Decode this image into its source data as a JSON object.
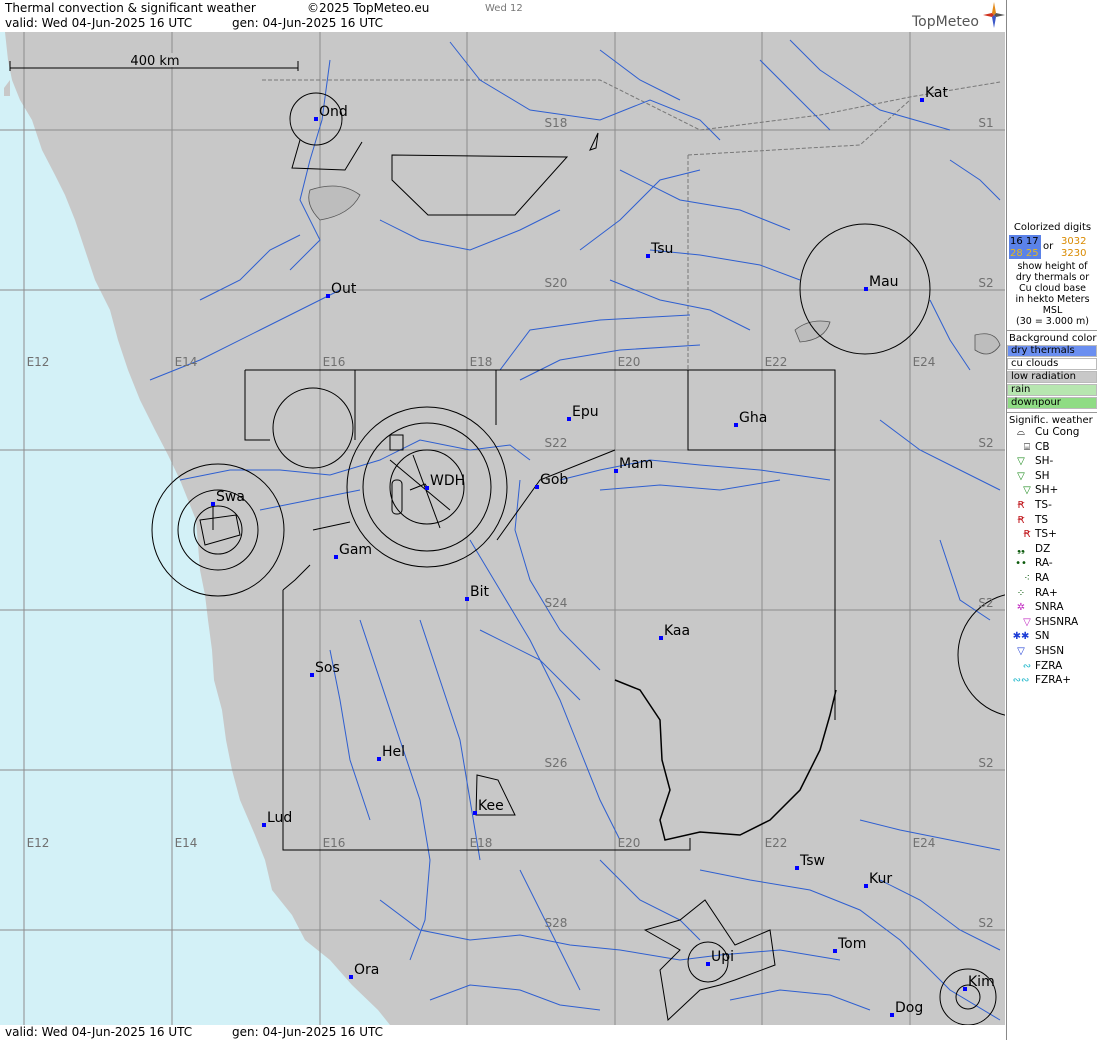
{
  "header": {
    "title": "Thermal convection & significant weather",
    "copyright": "©2025 TopMeteo.eu",
    "tab": "Wed 12",
    "valid": "valid:  Wed  04-Jun-2025  16 UTC",
    "generated": "gen: 04-Jun-2025 16 UTC",
    "logo": "TopMeteo"
  },
  "footer": {
    "valid": "valid:  Wed  04-Jun-2025  16 UTC",
    "generated": "gen: 04-Jun-2025 16 UTC"
  },
  "map": {
    "scale_label": "400 km",
    "colors": {
      "sea": "#d3f1f7",
      "land": "#c8c8c8",
      "river": "#2f5fd0",
      "grid": "#8c8c8c",
      "station": "#0000ff"
    },
    "places": [
      {
        "name": "Ond"
      },
      {
        "name": "Kat"
      },
      {
        "name": "Tsu"
      },
      {
        "name": "Mau"
      },
      {
        "name": "Out"
      },
      {
        "name": "Epu"
      },
      {
        "name": "Gha"
      },
      {
        "name": "Mam"
      },
      {
        "name": "Swa"
      },
      {
        "name": "WDH"
      },
      {
        "name": "Gob"
      },
      {
        "name": "Gam"
      },
      {
        "name": "Bit"
      },
      {
        "name": "Kaa"
      },
      {
        "name": "Sos"
      },
      {
        "name": "Hel"
      },
      {
        "name": "Kee"
      },
      {
        "name": "Lud"
      },
      {
        "name": "Tsw"
      },
      {
        "name": "Kur"
      },
      {
        "name": "Tom"
      },
      {
        "name": "Upi"
      },
      {
        "name": "Ora"
      },
      {
        "name": "Kim"
      },
      {
        "name": "Dog"
      }
    ],
    "lat_labels": [
      "S18",
      "S1",
      "S20",
      "S2",
      "S22",
      "S2",
      "S24",
      "S2",
      "S26",
      "S2",
      "S28",
      "S2"
    ],
    "lon_labels_top": [
      "E12",
      "E14",
      "E16",
      "E18",
      "E20",
      "E22",
      "E24"
    ],
    "lon_labels_bottom": [
      "E12",
      "E14",
      "E16",
      "E18",
      "E20",
      "E22",
      "E24"
    ]
  },
  "legend": {
    "colorized_title": "Colorized digits",
    "digits": {
      "a": "16 17",
      "b": "28 25",
      "or": "or",
      "c": "3032",
      "d": "3230"
    },
    "desc": [
      "show height of",
      "dry thermals or",
      "Cu cloud base",
      "in hekto Meters",
      "MSL",
      "(30 = 3.000 m)"
    ],
    "background_title": "Background color",
    "background": [
      {
        "label": "dry thermals",
        "color": "#6b8ff0"
      },
      {
        "label": "cu clouds",
        "color": "#ffffff"
      },
      {
        "label": "low radiation",
        "color": "#c8c8c8"
      },
      {
        "label": "rain",
        "color": "#b7e6b0"
      },
      {
        "label": "downpour",
        "color": "#8fdc84"
      }
    ],
    "weather_title": "Signific. weather",
    "weather": [
      {
        "label": "Cu Cong",
        "icon": "cu-cong-icon",
        "glyph": "⌓",
        "color": "#000000"
      },
      {
        "label": "CB",
        "icon": "cb-icon",
        "glyph": "⌸",
        "color": "#000000"
      },
      {
        "label": "SH-",
        "icon": "shower-light-icon",
        "glyph": "▽",
        "color": "#1b8a1b"
      },
      {
        "label": "SH",
        "icon": "shower-icon",
        "glyph": "▽",
        "color": "#1b8a1b"
      },
      {
        "label": "SH+",
        "icon": "shower-heavy-icon",
        "glyph": "▽",
        "color": "#1b8a1b"
      },
      {
        "label": "TS-",
        "icon": "thunderstorm-light-icon",
        "glyph": "Ꞧ",
        "color": "#c0161b"
      },
      {
        "label": "TS",
        "icon": "thunderstorm-icon",
        "glyph": "Ꞧ",
        "color": "#c0161b"
      },
      {
        "label": "TS+",
        "icon": "thunderstorm-heavy-icon",
        "glyph": "Ꞧ",
        "color": "#c0161b"
      },
      {
        "label": "DZ",
        "icon": "drizzle-icon",
        "glyph": "❟❟",
        "color": "#0b5a0b"
      },
      {
        "label": "RA-",
        "icon": "rain-light-icon",
        "glyph": "••",
        "color": "#0b5a0b"
      },
      {
        "label": "RA",
        "icon": "rain-icon",
        "glyph": "⁖",
        "color": "#0b5a0b"
      },
      {
        "label": "RA+",
        "icon": "rain-heavy-icon",
        "glyph": "⁘",
        "color": "#0b5a0b"
      },
      {
        "label": "SNRA",
        "icon": "snow-rain-icon",
        "glyph": "✲",
        "color": "#c026c0"
      },
      {
        "label": "SHSNRA",
        "icon": "shower-snow-rain-icon",
        "glyph": "▽",
        "color": "#c026c0"
      },
      {
        "label": "SN",
        "icon": "snow-icon",
        "glyph": "✱✱",
        "color": "#1f3fd6"
      },
      {
        "label": "SHSN",
        "icon": "shower-snow-icon",
        "glyph": "▽",
        "color": "#1f3fd6"
      },
      {
        "label": "FZRA",
        "icon": "freezing-rain-icon",
        "glyph": "∾",
        "color": "#19b5c9"
      },
      {
        "label": "FZRA+",
        "icon": "freezing-rain-heavy-icon",
        "glyph": "∾∾",
        "color": "#19b5c9"
      }
    ]
  }
}
